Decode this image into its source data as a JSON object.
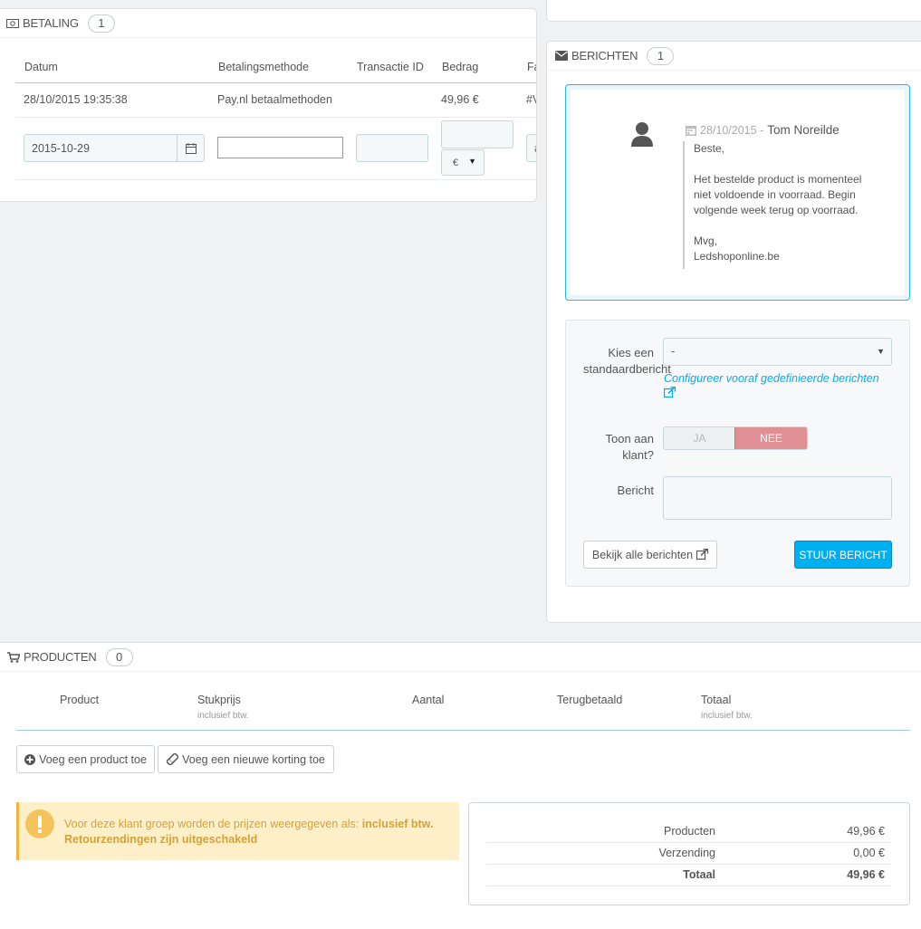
{
  "colors": {
    "accent": "#00aff0",
    "danger_soft": "#e08f95",
    "warning_bg": "#fdf0c9",
    "warning_text": "#d5a13a"
  },
  "payment": {
    "title": "BETALING",
    "count": "1",
    "columns": [
      "Datum",
      "Betalingsmethode",
      "Transactie ID",
      "Bedrag",
      "Fact"
    ],
    "row": {
      "date": "28/10/2015 19:35:38",
      "method": "Pay.nl betaalmethoden",
      "amount": "49,96 €",
      "invoice": "#VF"
    },
    "form": {
      "date_value": "2015-10-29",
      "currency": "€",
      "invoice_value": "#V"
    }
  },
  "messages": {
    "title": "BERICHTEN",
    "count": "1",
    "msg": {
      "date": "28/10/2015 -",
      "author": "Tom Noreilde",
      "lines": [
        "Beste,",
        "",
        "Het bestelde product is momenteel",
        "niet voldoende in voorraad. Begin",
        "volgende week terug op voorraad.",
        "",
        "Mvg,",
        "Ledshoponline.be"
      ]
    },
    "form": {
      "choose_label_1": "Kies een",
      "choose_label_2": "standaardbericht",
      "select_value": "-",
      "configure_link": "Configureer vooraf gedefinieerde berichten",
      "show_label_1": "Toon aan",
      "show_label_2": "klant?",
      "yes": "JA",
      "no": "NEE",
      "message_label": "Bericht",
      "view_all": "Bekijk alle berichten",
      "send": "STUUR BERICHT"
    }
  },
  "products": {
    "title": "PRODUCTEN",
    "count": "0",
    "columns": {
      "product": "Product",
      "unit_price": "Stukprijs",
      "unit_price_sub": "inclusief btw.",
      "quantity": "Aantal",
      "refunded": "Terugbetaald",
      "total": "Totaal",
      "total_sub": "inclusief btw."
    },
    "add_product": "Voeg een product toe",
    "add_discount": "Voeg een nieuwe korting toe",
    "warning": {
      "text": "Voor deze klant groep worden de prijzen weergegeven als:",
      "bold1": "inclusief btw.",
      "bold2": "Retourzendingen zijn uitgeschakeld"
    },
    "totals": [
      {
        "label": "Producten",
        "value": "49,96 €"
      },
      {
        "label": "Verzending",
        "value": "0,00 €"
      },
      {
        "label": "Totaal",
        "value": "49,96 €"
      }
    ]
  }
}
